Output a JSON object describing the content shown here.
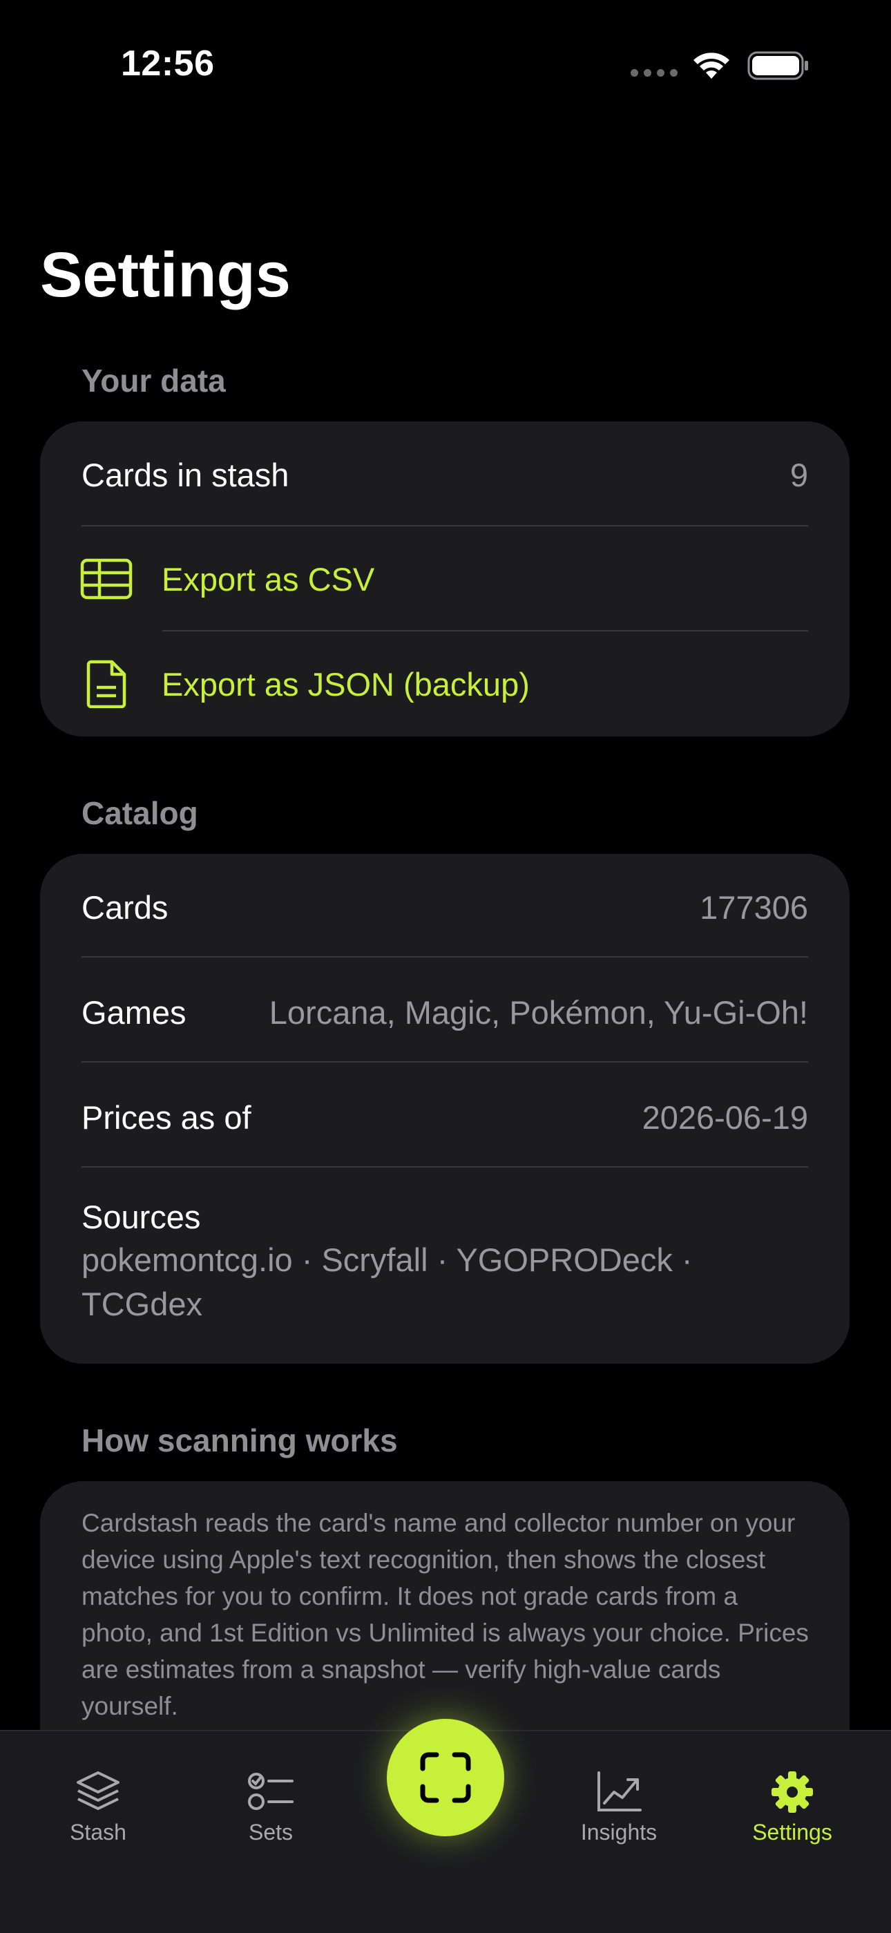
{
  "status_bar": {
    "time": "12:56"
  },
  "page": {
    "title": "Settings"
  },
  "your_data": {
    "header": "Your data",
    "cards_in_stash_label": "Cards in stash",
    "cards_in_stash_value": "9",
    "export_csv_label": "Export as CSV",
    "export_json_label": "Export as JSON (backup)"
  },
  "catalog": {
    "header": "Catalog",
    "rows": [
      {
        "label": "Cards",
        "value": "177306"
      },
      {
        "label": "Games",
        "value": "Lorcana, Magic, Pokémon, Yu-Gi-Oh!"
      },
      {
        "label": "Prices as of",
        "value": "2026-06-19"
      }
    ],
    "sources_label": "Sources",
    "sources_value": "pokemontcg.io · Scryfall · YGOPRODeck · TCGdex"
  },
  "scanning": {
    "header": "How scanning works",
    "body": "Cardstash reads the card's name and collector number on your device using Apple's text recognition, then shows the closest matches for you to confirm. It does not grade cards from a photo, and 1st Edition vs Unlimited is always your choice. Prices are estimates from a snapshot — verify high-value cards yourself."
  },
  "tab_bar": {
    "tabs": [
      {
        "label": "Stash",
        "icon": "stack-icon",
        "active": false
      },
      {
        "label": "Sets",
        "icon": "checklist-icon",
        "active": false
      },
      {
        "label": "Insights",
        "icon": "chart-line-icon",
        "active": false
      },
      {
        "label": "Settings",
        "icon": "gear-icon",
        "active": true
      }
    ],
    "scan_icon": "scan-frame-icon"
  },
  "colors": {
    "accent": "#c7f03a",
    "background": "#000000",
    "card_background": "#1c1c1e",
    "secondary_text": "#98989d",
    "tab_bar_background": "#1b1b1f"
  }
}
